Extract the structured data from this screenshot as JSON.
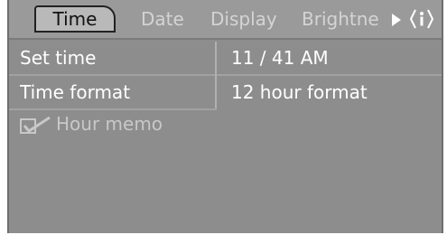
{
  "tabs": {
    "time": "Time",
    "date": "Date",
    "display": "Display",
    "brightness": "Brightne"
  },
  "icons": {
    "next": "right-arrow-icon",
    "info": "info-icon",
    "checkbox": "checkbox-checked-icon"
  },
  "settings": {
    "rows": [
      {
        "label": "Set time",
        "value": "11 / 41 AM"
      },
      {
        "label": "Time format",
        "value": "12 hour format"
      }
    ],
    "hour_memo": {
      "label": "Hour memo",
      "checked": true
    }
  },
  "colors": {
    "background": "#8d8d8d",
    "tabbar": "#9a9a9a",
    "active_tab": "#b9b9b9",
    "text": "#ffffff",
    "muted_text": "#d4d4d4"
  }
}
